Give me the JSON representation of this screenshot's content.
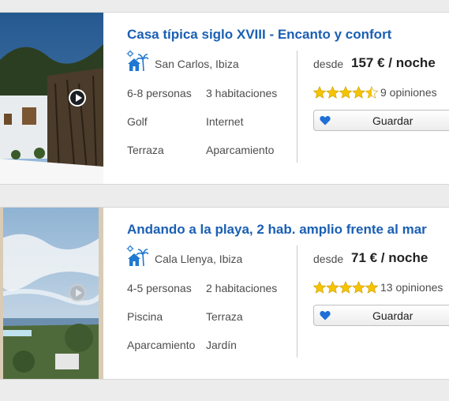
{
  "listings": [
    {
      "title": "Casa típica siglo XVIII - Encanto y confort",
      "location": "San Carlos, Ibiza",
      "features": [
        "6-8 personas",
        "3 habitaciones",
        "Golf",
        "Internet",
        "Terraza",
        "Aparcamiento"
      ],
      "desde_label": "desde",
      "price": "157 € / noche",
      "rating": 4.5,
      "reviews": "9 opiniones",
      "save_label": "Guardar"
    },
    {
      "title": "Andando a la playa, 2 hab. amplio frente al mar",
      "location": "Cala Llenya, Ibiza",
      "features": [
        "4-5 personas",
        "2 habitaciones",
        "Piscina",
        "Terraza",
        "Aparcamiento",
        "Jardín"
      ],
      "desde_label": "desde",
      "price": "71 € / noche",
      "rating": 5,
      "reviews": "13 opiniones",
      "save_label": "Guardar"
    }
  ],
  "icons": {
    "location": "villa-palm-sun-icon",
    "play": "play-video-icon",
    "save": "heart-icon",
    "rating": "star-icon"
  },
  "colors": {
    "title": "#1a5fb4",
    "icon_blue": "#1f78d1",
    "star": "#f5c400"
  }
}
